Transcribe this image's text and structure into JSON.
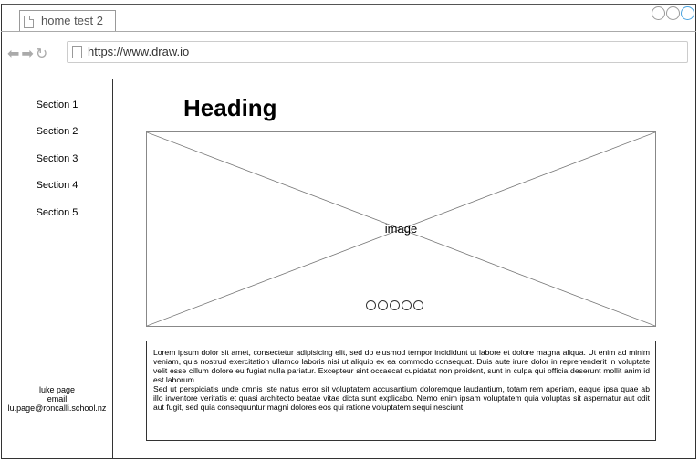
{
  "browser": {
    "tab_title": "home test 2",
    "url": "https://www.draw.io"
  },
  "sidebar": {
    "sections": [
      {
        "label": "Section 1"
      },
      {
        "label": "Section 2"
      },
      {
        "label": "Section 3"
      },
      {
        "label": "Section 4"
      },
      {
        "label": "Section 5"
      }
    ],
    "contact": {
      "name": "luke page",
      "email_label": "email",
      "email": "lu.page@roncalli.school.nz"
    }
  },
  "main": {
    "heading": "Heading",
    "image_label": "image",
    "carousel_dots": 5,
    "paragraph_1": "Lorem ipsum dolor sit amet, consectetur adipisicing elit, sed do eiusmod tempor incididunt ut labore et dolore magna aliqua. Ut enim ad minim veniam, quis nostrud exercitation ullamco laboris nisi ut aliquip ex ea commodo consequat. Duis aute irure dolor in reprehenderit in voluptate velit esse cillum dolore eu fugiat nulla pariatur. Excepteur sint occaecat cupidatat non proident, sunt in culpa qui officia deserunt mollit anim id est laborum.",
    "paragraph_2": "Sed ut perspiciatis unde omnis iste natus error sit voluptatem accusantium doloremque laudantium, totam rem aperiam, eaque ipsa quae ab illo inventore veritatis et quasi architecto beatae vitae dicta sunt explicabo. Nemo enim ipsam voluptatem quia voluptas sit aspernatur aut odit aut fugit, sed quia consequuntur magni dolores eos qui ratione voluptatem sequi nesciunt."
  },
  "icons": {
    "back": "arrow-left-icon",
    "forward": "arrow-right-icon",
    "refresh": "refresh-icon",
    "page": "page-icon"
  },
  "colors": {
    "window_control_active": "#4aa3df",
    "border": "#333333"
  }
}
